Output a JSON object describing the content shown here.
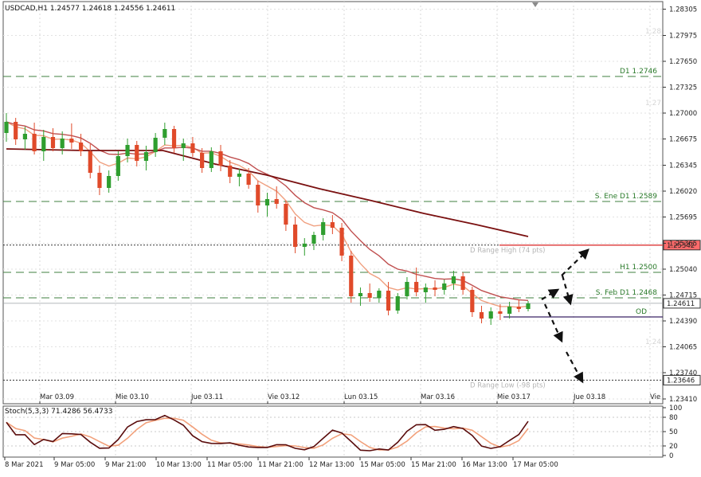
{
  "chart_data": {
    "type": "candlestick",
    "title": "USDCAD,H1  1.24577 1.24618 1.24556 1.24611",
    "symbol": "USDCAD",
    "timeframe": "H1",
    "last_price": "1.24611",
    "ylim": [
      1.2335,
      1.284
    ],
    "y_ticks": [
      "1.28305",
      "1.27975",
      "1.27650",
      "1.27325",
      "1.27000",
      "1.26675",
      "1.26345",
      "1.26020",
      "1.25695",
      "1.25365",
      "1.25040",
      "1.24715",
      "1.24390",
      "1.24065",
      "1.23740",
      "1.23410"
    ],
    "ghost_labels": [
      "1.28",
      "1.27",
      "1.24"
    ],
    "top_time_labels": [
      "Mar 03.09",
      "Mie 03.10",
      "Jue 03.11",
      "Vie 03.12",
      "Lun 03.15",
      "Mar 03.16",
      "Mie 03.17",
      "Jue 03.18",
      "Vie"
    ],
    "x_time_labels": [
      "8 Mar 2021",
      "9 Mar 05:00",
      "9 Mar 21:00",
      "10 Mar 13:00",
      "11 Mar 05:00",
      "11 Mar 21:00",
      "12 Mar 13:00",
      "15 Mar 05:00",
      "15 Mar 21:00",
      "16 Mar 13:00",
      "17 Mar 05:00"
    ],
    "levels": [
      {
        "label": "D1 1.2746",
        "price": 1.2746,
        "style": "dashed",
        "color": "#3f7f3f"
      },
      {
        "label": "S. Ene D1 1.2589",
        "price": 1.2589,
        "style": "dashed",
        "color": "#3f7f3f"
      },
      {
        "label": "D Range High (74 pts)",
        "price": 1.25342,
        "style": "dotted",
        "color": "#333333",
        "price_tag": "1.25342",
        "tag_color": "#ff6b6b"
      },
      {
        "label": "H1 1.2500",
        "price": 1.25,
        "style": "dashed",
        "color": "#3f7f3f"
      },
      {
        "label": "S. Feb D1 1.2468",
        "price": 1.2468,
        "style": "dashed",
        "color": "#3f7f3f"
      },
      {
        "label": "OD",
        "price": 1.2444,
        "style": "solid",
        "color": "#3a2466"
      },
      {
        "label": "D Range Low (-98 pts)",
        "price": 1.23646,
        "style": "dotted",
        "color": "#333333",
        "price_tag": "1.23646",
        "tag_color": "#ffffff"
      }
    ],
    "ma_200_points": [
      [
        0,
        1.2655
      ],
      [
        0.15,
        1.2653
      ],
      [
        0.3,
        1.2653
      ],
      [
        0.4,
        1.2636
      ],
      [
        0.5,
        1.2622
      ],
      [
        0.6,
        1.2605
      ],
      [
        0.7,
        1.259
      ],
      [
        0.8,
        1.2574
      ],
      [
        0.9,
        1.256
      ],
      [
        1.0,
        1.2545
      ]
    ],
    "stochastic": {
      "label": "Stoch(5,3,3) 71.4286 56.4733",
      "main": 71.4286,
      "signal": 56.4733,
      "levels": [
        0,
        20,
        50,
        80,
        100
      ]
    },
    "candles": [
      [
        1.2675,
        1.27,
        1.2664,
        1.2689
      ],
      [
        1.2689,
        1.2694,
        1.266,
        1.2667
      ],
      [
        1.2667,
        1.2683,
        1.2654,
        1.2674
      ],
      [
        1.2674,
        1.2688,
        1.2648,
        1.2652
      ],
      [
        1.2652,
        1.2679,
        1.264,
        1.267
      ],
      [
        1.267,
        1.2681,
        1.2652,
        1.2656
      ],
      [
        1.2656,
        1.2677,
        1.2648,
        1.2668
      ],
      [
        1.2668,
        1.2687,
        1.2655,
        1.2663
      ],
      [
        1.2663,
        1.2674,
        1.2646,
        1.2652
      ],
      [
        1.2652,
        1.2661,
        1.2618,
        1.2625
      ],
      [
        1.2625,
        1.2634,
        1.2597,
        1.2606
      ],
      [
        1.2606,
        1.2628,
        1.26,
        1.2621
      ],
      [
        1.2621,
        1.2652,
        1.2615,
        1.2646
      ],
      [
        1.2646,
        1.2668,
        1.2638,
        1.266
      ],
      [
        1.266,
        1.2665,
        1.2633,
        1.264
      ],
      [
        1.264,
        1.2659,
        1.2628,
        1.2651
      ],
      [
        1.2651,
        1.2675,
        1.2645,
        1.2669
      ],
      [
        1.2669,
        1.2688,
        1.266,
        1.268
      ],
      [
        1.268,
        1.2684,
        1.265,
        1.2656
      ],
      [
        1.2656,
        1.2668,
        1.264,
        1.2662
      ],
      [
        1.2662,
        1.267,
        1.2645,
        1.265
      ],
      [
        1.265,
        1.2656,
        1.2625,
        1.2631
      ],
      [
        1.2631,
        1.2657,
        1.2626,
        1.2652
      ],
      [
        1.2652,
        1.266,
        1.2627,
        1.2634
      ],
      [
        1.2634,
        1.2641,
        1.2612,
        1.262
      ],
      [
        1.262,
        1.263,
        1.2608,
        1.2624
      ],
      [
        1.2624,
        1.2631,
        1.2605,
        1.261
      ],
      [
        1.261,
        1.2615,
        1.2575,
        1.2584
      ],
      [
        1.2584,
        1.26,
        1.257,
        1.2592
      ],
      [
        1.2592,
        1.2608,
        1.258,
        1.2586
      ],
      [
        1.2586,
        1.259,
        1.2552,
        1.256
      ],
      [
        1.256,
        1.257,
        1.2524,
        1.2532
      ],
      [
        1.2532,
        1.2543,
        1.2521,
        1.2536
      ],
      [
        1.2536,
        1.2551,
        1.2528,
        1.2547
      ],
      [
        1.2547,
        1.2568,
        1.254,
        1.2563
      ],
      [
        1.2563,
        1.2572,
        1.2548,
        1.2556
      ],
      [
        1.2556,
        1.2562,
        1.2514,
        1.2521
      ],
      [
        1.2521,
        1.2527,
        1.2462,
        1.247
      ],
      [
        1.247,
        1.2481,
        1.2458,
        1.2474
      ],
      [
        1.2474,
        1.2486,
        1.2463,
        1.2468
      ],
      [
        1.2468,
        1.248,
        1.2462,
        1.2477
      ],
      [
        1.2477,
        1.2488,
        1.2446,
        1.2452
      ],
      [
        1.2452,
        1.2474,
        1.2448,
        1.247
      ],
      [
        1.247,
        1.2494,
        1.2466,
        1.2488
      ],
      [
        1.2488,
        1.2506,
        1.247,
        1.2475
      ],
      [
        1.2475,
        1.2486,
        1.2462,
        1.2481
      ],
      [
        1.2481,
        1.249,
        1.247,
        1.2478
      ],
      [
        1.2478,
        1.2491,
        1.2472,
        1.2486
      ],
      [
        1.2486,
        1.2502,
        1.2478,
        1.2495
      ],
      [
        1.2495,
        1.25,
        1.2472,
        1.2478
      ],
      [
        1.2478,
        1.2482,
        1.2444,
        1.245
      ],
      [
        1.245,
        1.2458,
        1.2436,
        1.2442
      ],
      [
        1.2442,
        1.2456,
        1.2434,
        1.2451
      ],
      [
        1.2451,
        1.246,
        1.244,
        1.2448
      ],
      [
        1.2448,
        1.2463,
        1.2442,
        1.2457
      ],
      [
        1.2457,
        1.2466,
        1.245,
        1.2454
      ],
      [
        1.2454,
        1.2464,
        1.2451,
        1.2461
      ]
    ]
  }
}
